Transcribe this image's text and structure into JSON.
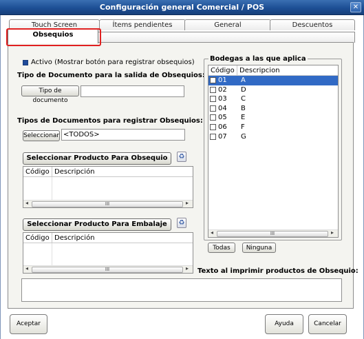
{
  "window": {
    "title": "Configuración general Comercial / POS",
    "close_glyph": "✕"
  },
  "tabs_row1": [
    {
      "label": "Touch Screen"
    },
    {
      "label": "Ítems pendientes"
    },
    {
      "label": "General"
    },
    {
      "label": "Descuentos"
    }
  ],
  "active_tab": {
    "label": "Obsequios"
  },
  "obsequios": {
    "activo_label": "Activo (Mostrar botón para registrar obsequios)",
    "tipo_doc_salida_heading": "Tipo de Documento para la salida de Obsequios:",
    "tipo_doc_button": "Tipo de documento",
    "tipo_doc_value": "",
    "tipos_doc_registrar_heading": "Tipos de Documentos para registrar Obsequios:",
    "seleccionar_button": "Seleccionar",
    "tipos_doc_value": "<TODOS>",
    "sel_prod_obsequio_button": "Seleccionar Producto Para Obsequio",
    "sel_prod_embalaje_button": "Seleccionar Producto Para Embalaje",
    "grid_columns": [
      "Código",
      "Descripción"
    ],
    "scroll_thumb_glyph": "III",
    "scroll_left_glyph": "◂",
    "scroll_right_glyph": "▸",
    "texto_imprimir_label": "Texto al imprimir productos de Obsequio:",
    "texto_imprimir_value": ""
  },
  "bodegas": {
    "title": "Bodegas a las que aplica",
    "columns": [
      "Código",
      "Descripcion"
    ],
    "rows": [
      {
        "code": "01",
        "desc": "A",
        "checked": false,
        "selected": true
      },
      {
        "code": "02",
        "desc": "D",
        "checked": false,
        "selected": false
      },
      {
        "code": "03",
        "desc": "C",
        "checked": false,
        "selected": false
      },
      {
        "code": "04",
        "desc": "B",
        "checked": false,
        "selected": false
      },
      {
        "code": "05",
        "desc": "E",
        "checked": false,
        "selected": false
      },
      {
        "code": "06",
        "desc": "F",
        "checked": false,
        "selected": false
      },
      {
        "code": "07",
        "desc": "G",
        "checked": false,
        "selected": false
      }
    ],
    "todas_button": "Todas",
    "ninguna_button": "Ninguna"
  },
  "footer": {
    "aceptar": "Aceptar",
    "ayuda": "Ayuda",
    "cancelar": "Cancelar"
  },
  "colors": {
    "titlebar": "#1d4f95",
    "selection": "#316ac5",
    "highlight_box": "#e02020"
  }
}
